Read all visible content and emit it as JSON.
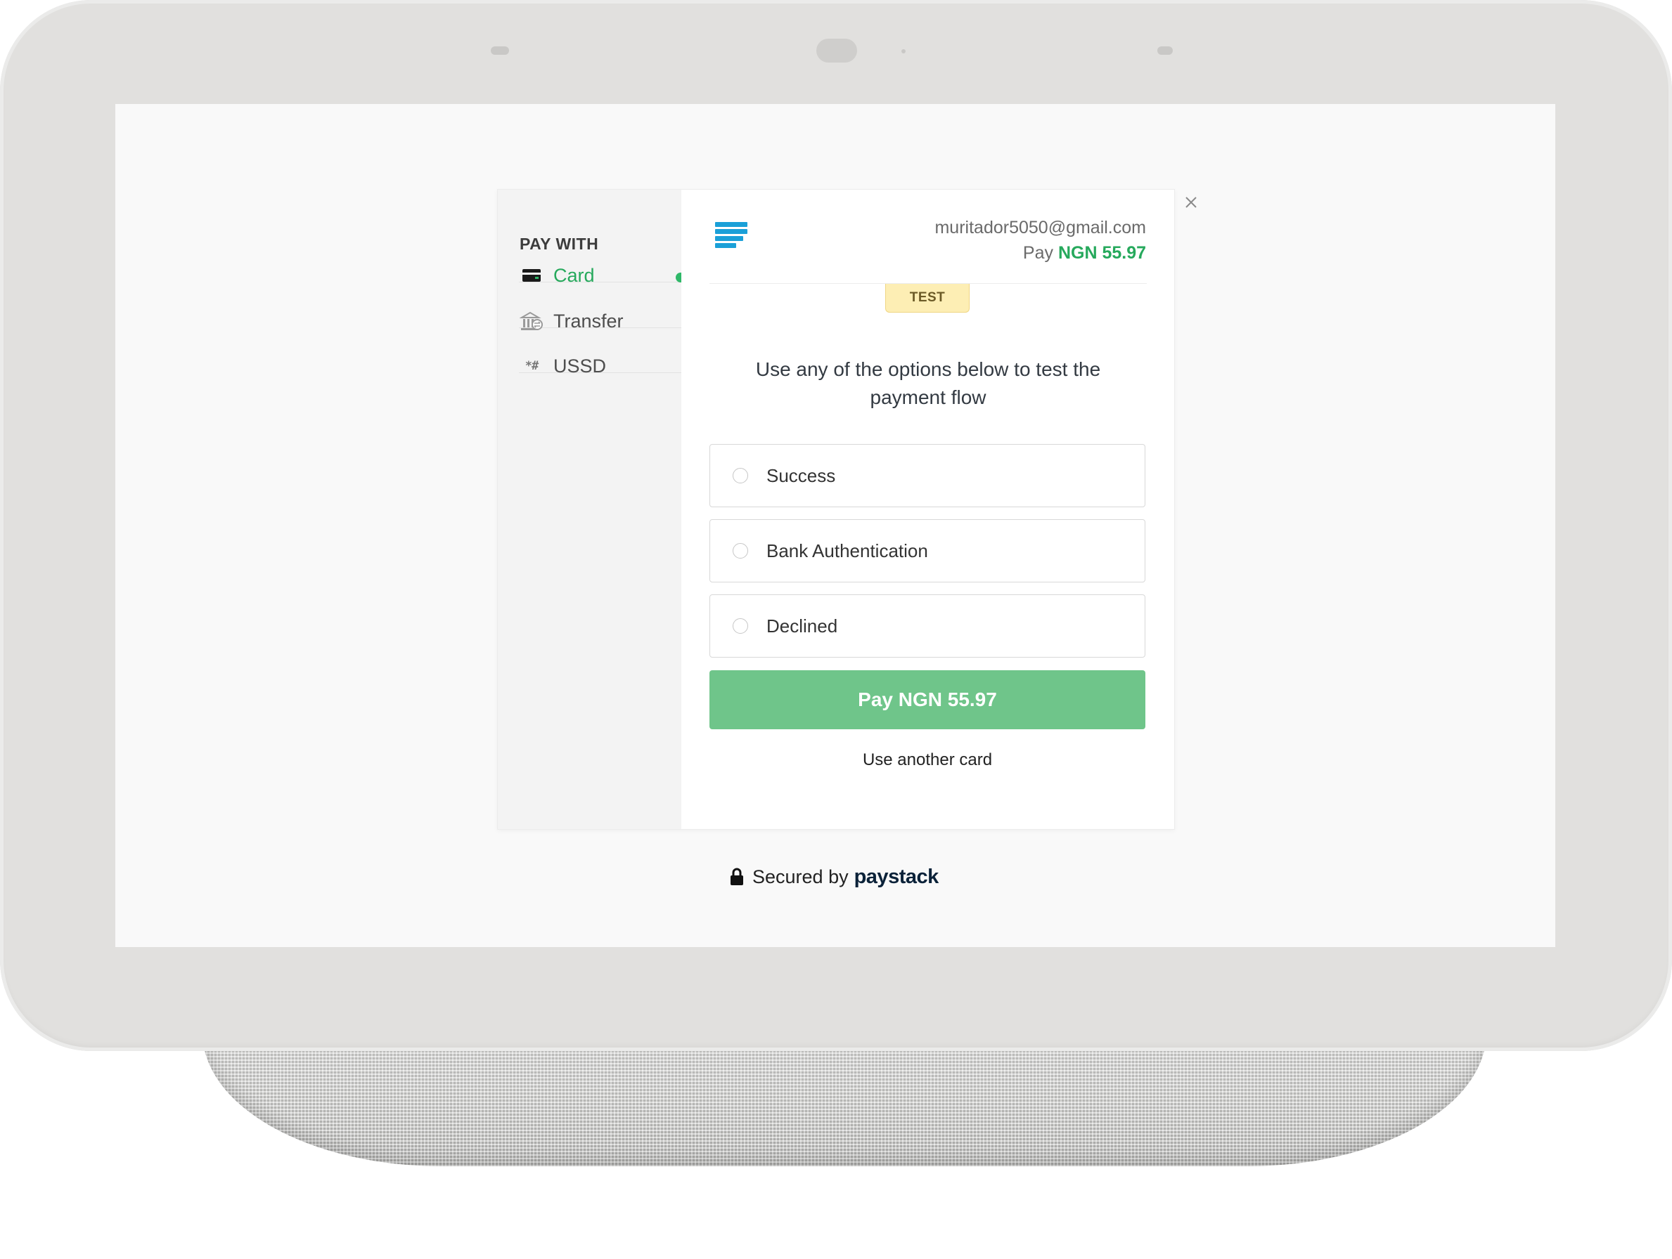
{
  "sidebar": {
    "heading": "PAY WITH",
    "items": [
      {
        "label": "Card",
        "icon": "credit-card-icon",
        "active": true
      },
      {
        "label": "Transfer",
        "icon": "bank-transfer-icon",
        "active": false
      },
      {
        "label": "USSD",
        "icon": "ussd-icon",
        "icon_glyph": "*#",
        "active": false
      }
    ]
  },
  "header": {
    "merchant_logo": "merchant-logo-icon",
    "email": "muritador5050@gmail.com",
    "pay_prefix": "Pay",
    "amount": "NGN 55.97"
  },
  "badge": {
    "label": "TEST"
  },
  "instructions": "Use any of the options below to test the payment flow",
  "options": [
    {
      "label": "Success",
      "selected": false
    },
    {
      "label": "Bank Authentication",
      "selected": false
    },
    {
      "label": "Declined",
      "selected": false
    }
  ],
  "pay_button": {
    "label": "Pay NGN 55.97"
  },
  "secondary_link": {
    "label": "Use another card"
  },
  "footer": {
    "secured_text": "Secured by",
    "brand": "paystack",
    "icon": "lock-icon"
  },
  "close_icon": "close-icon",
  "colors": {
    "accent_green": "#26a95c",
    "pay_button": "#6fc58a",
    "test_badge": "#fdeeb4",
    "merchant_logo": "#1ba0d8",
    "brand_navy": "#0b2239"
  }
}
